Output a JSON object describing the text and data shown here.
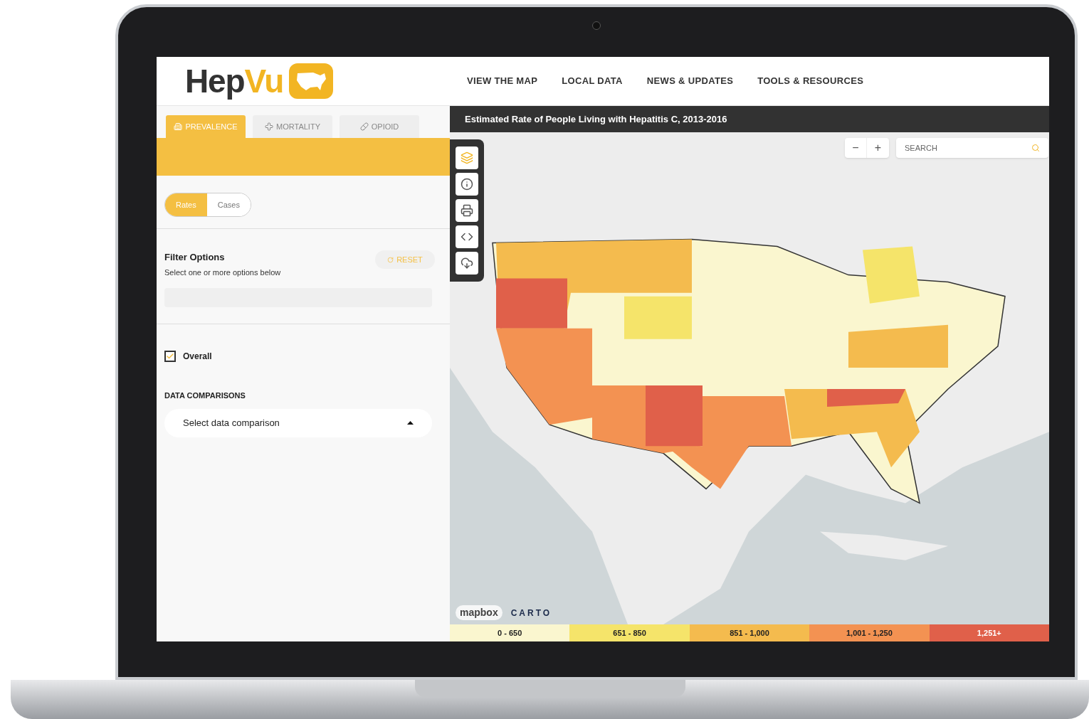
{
  "brand": {
    "name_dark": "Hep",
    "name_accent": "Vu"
  },
  "nav": [
    "VIEW THE MAP",
    "LOCAL DATA",
    "NEWS & UPDATES",
    "TOOLS & RESOURCES"
  ],
  "tabs": [
    {
      "label": "PREVALENCE",
      "selected": true
    },
    {
      "label": "MORTALITY",
      "selected": false
    },
    {
      "label": "OPIOID",
      "selected": false
    }
  ],
  "toggle": [
    {
      "label": "Rates",
      "selected": true
    },
    {
      "label": "Cases",
      "selected": false
    }
  ],
  "filter": {
    "title": "Filter Options",
    "subtitle": "Select one or more options below",
    "reset": "RESET"
  },
  "overall": {
    "label": "Overall",
    "checked": true
  },
  "comparisons": {
    "heading": "DATA COMPARISONS",
    "value": "Select data comparison"
  },
  "map": {
    "title": "Estimated Rate of People Living with Hepatitis C, 2013-2016",
    "zoom_out": "−",
    "zoom_in": "+",
    "search_placeholder": "SEARCH",
    "attribution": [
      "mapbox",
      "CARTO"
    ],
    "legend": [
      {
        "label": "0 - 650",
        "color": "#faf6cf"
      },
      {
        "label": "651 - 850",
        "color": "#f5e46a"
      },
      {
        "label": "851 - 1,000",
        "color": "#f4bb4e"
      },
      {
        "label": "1,001 - 1,250",
        "color": "#f39252"
      },
      {
        "label": "1,251+",
        "color": "#e0604a"
      }
    ]
  }
}
